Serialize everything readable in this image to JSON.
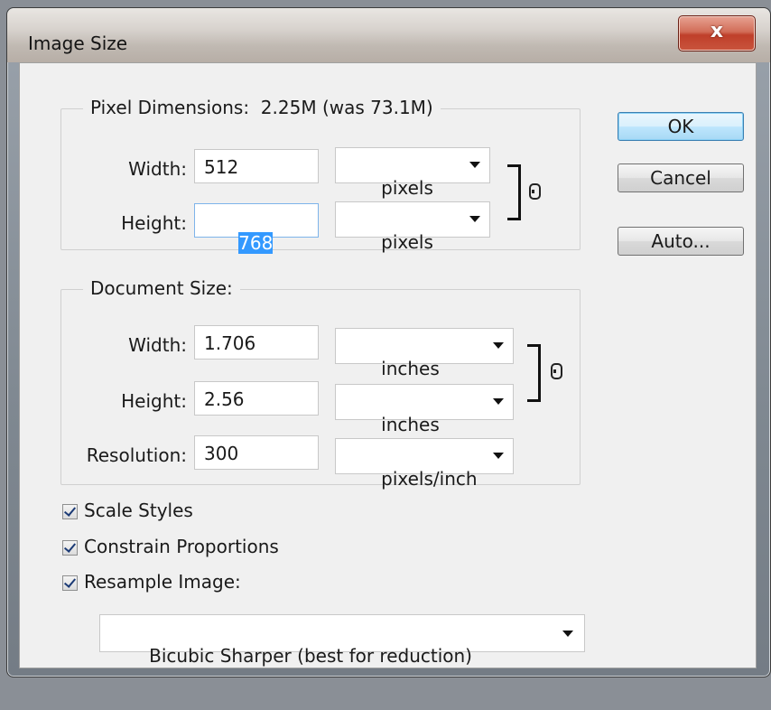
{
  "window": {
    "title": "Image Size",
    "close_symbol": "x"
  },
  "buttons": {
    "ok": "OK",
    "cancel": "Cancel",
    "auto": "Auto..."
  },
  "pixel_dimensions": {
    "legend": "Pixel Dimensions:  2.25M (was 73.1M)",
    "width_label": "Width:",
    "width_value": "512",
    "width_unit": "pixels",
    "height_label": "Height:",
    "height_value": "768",
    "height_unit": "pixels"
  },
  "document_size": {
    "legend": "Document Size:",
    "width_label": "Width:",
    "width_value": "1.706",
    "width_unit": "inches",
    "height_label": "Height:",
    "height_value": "2.56",
    "height_unit": "inches",
    "resolution_label": "Resolution:",
    "resolution_value": "300",
    "resolution_unit": "pixels/inch"
  },
  "options": {
    "scale_styles": "Scale Styles",
    "constrain_proportions": "Constrain Proportions",
    "resample_image": "Resample Image:",
    "resample_method": "Bicubic Sharper (best for reduction)"
  },
  "colors": {
    "selection": "#3399ff",
    "close_button": "#c9543d",
    "default_button_border": "#3c7fb1"
  }
}
